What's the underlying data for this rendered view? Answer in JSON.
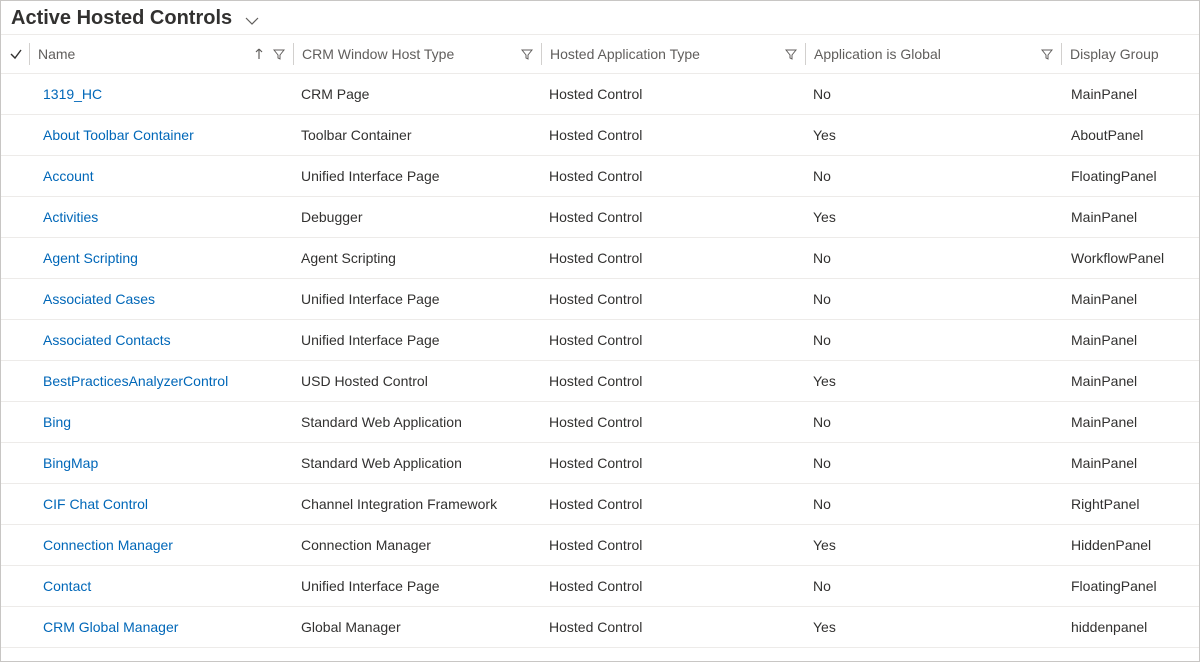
{
  "view": {
    "title": "Active Hosted Controls"
  },
  "columns": {
    "name": "Name",
    "host": "CRM Window Host Type",
    "type": "Hosted Application Type",
    "glob": "Application is Global",
    "disp": "Display Group"
  },
  "rows": [
    {
      "name": "1319_HC",
      "host": "CRM Page",
      "type": "Hosted Control",
      "glob": "No",
      "disp": "MainPanel"
    },
    {
      "name": "About Toolbar Container",
      "host": "Toolbar Container",
      "type": "Hosted Control",
      "glob": "Yes",
      "disp": "AboutPanel"
    },
    {
      "name": "Account",
      "host": "Unified Interface Page",
      "type": "Hosted Control",
      "glob": "No",
      "disp": "FloatingPanel"
    },
    {
      "name": "Activities",
      "host": "Debugger",
      "type": "Hosted Control",
      "glob": "Yes",
      "disp": "MainPanel"
    },
    {
      "name": "Agent Scripting",
      "host": "Agent Scripting",
      "type": "Hosted Control",
      "glob": "No",
      "disp": "WorkflowPanel"
    },
    {
      "name": "Associated Cases",
      "host": "Unified Interface Page",
      "type": "Hosted Control",
      "glob": "No",
      "disp": "MainPanel"
    },
    {
      "name": "Associated Contacts",
      "host": "Unified Interface Page",
      "type": "Hosted Control",
      "glob": "No",
      "disp": "MainPanel"
    },
    {
      "name": "BestPracticesAnalyzerControl",
      "host": "USD Hosted Control",
      "type": "Hosted Control",
      "glob": "Yes",
      "disp": "MainPanel"
    },
    {
      "name": "Bing",
      "host": "Standard Web Application",
      "type": "Hosted Control",
      "glob": "No",
      "disp": "MainPanel"
    },
    {
      "name": "BingMap",
      "host": "Standard Web Application",
      "type": "Hosted Control",
      "glob": "No",
      "disp": "MainPanel"
    },
    {
      "name": "CIF Chat Control",
      "host": "Channel Integration Framework",
      "type": "Hosted Control",
      "glob": "No",
      "disp": "RightPanel"
    },
    {
      "name": "Connection Manager",
      "host": "Connection Manager",
      "type": "Hosted Control",
      "glob": "Yes",
      "disp": "HiddenPanel"
    },
    {
      "name": "Contact",
      "host": "Unified Interface Page",
      "type": "Hosted Control",
      "glob": "No",
      "disp": "FloatingPanel"
    },
    {
      "name": "CRM Global Manager",
      "host": "Global Manager",
      "type": "Hosted Control",
      "glob": "Yes",
      "disp": "hiddenpanel"
    }
  ]
}
